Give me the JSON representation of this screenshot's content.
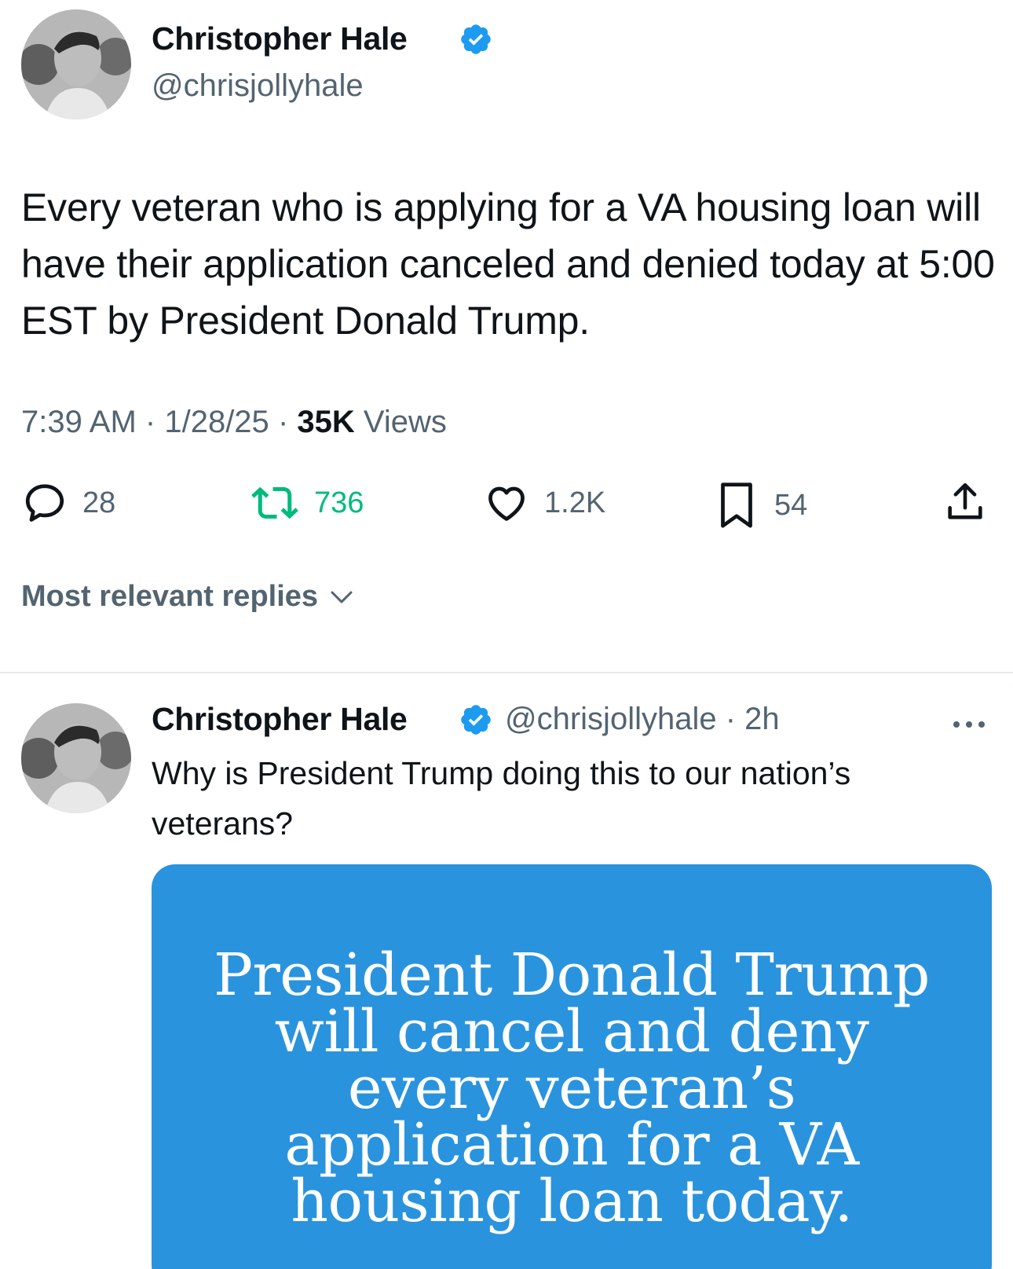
{
  "tweet": {
    "author_name": "Christopher Hale",
    "author_handle": "@chrisjollyhale",
    "text": "Every veteran who is applying for a VA housing loan will have their application canceled and denied today at 5:00 EST by President Donald Trump.",
    "time": "7:39 AM",
    "date": "1/28/25",
    "separator": "·",
    "views_count": "35K",
    "views_label": "Views",
    "actions": {
      "replies": "28",
      "reposts": "736",
      "likes": "1.2K",
      "bookmarks": "54"
    },
    "icons": [
      "reply-icon",
      "repost-icon",
      "like-icon",
      "bookmark-icon",
      "share-icon",
      "verified-badge-icon"
    ],
    "colors": {
      "verified": "#1d9bf0",
      "repost": "#00ba7c",
      "secondary_text": "#536471",
      "media_bg": "#2a93de"
    }
  },
  "replies_sort": {
    "label": "Most relevant replies"
  },
  "reply": {
    "author_name": "Christopher Hale",
    "author_handle": "@chrisjollyhale",
    "age": "2h",
    "separator": "·",
    "text": "Why is President Trump doing this to our nation’s veterans?",
    "media_lines": [
      "President Donald Trump",
      "will cancel and deny",
      "every veteran’s",
      "application for a VA",
      "housing loan today."
    ]
  }
}
